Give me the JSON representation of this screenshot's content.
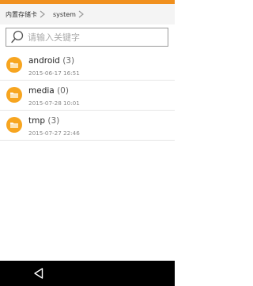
{
  "colors": {
    "accent": "#f0901e",
    "folder": "#f7a520",
    "navbar": "#000000"
  },
  "breadcrumb": {
    "items": [
      {
        "label": "内置存储卡"
      },
      {
        "label": "system"
      }
    ]
  },
  "search": {
    "placeholder": "请输入关键字",
    "value": ""
  },
  "files": [
    {
      "name": "android",
      "count": "(3)",
      "modified": "2015-06-17 16:51",
      "icon": "folder-icon"
    },
    {
      "name": "media",
      "count": "(0)",
      "modified": "2015-07-28 10:01",
      "icon": "folder-icon"
    },
    {
      "name": "tmp",
      "count": "(3)",
      "modified": "2015-07-27 22:46",
      "icon": "folder-icon"
    }
  ],
  "navbar": {
    "icons": [
      "back-icon"
    ]
  }
}
